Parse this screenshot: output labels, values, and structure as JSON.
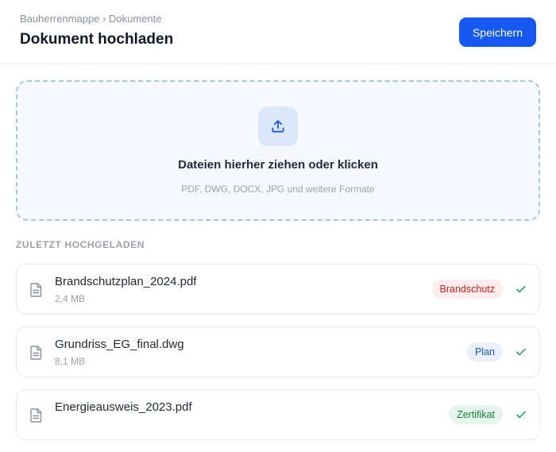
{
  "header": {
    "breadcrumb": "Bauherrenmappe › Dokumente",
    "title": "Dokument hochladen",
    "save_label": "Speichern"
  },
  "dropzone": {
    "icon": "upload-icon",
    "title": "Dateien hierher ziehen oder klicken",
    "hint": "PDF, DWG, DOCX, JPG und weitere Formate"
  },
  "recent": {
    "label": "ZULETZT HOCHGELADEN",
    "files": [
      {
        "name": "Brandschutzplan_2024.pdf",
        "size": "2,4 MB",
        "tag": "Brandschutz",
        "tag_color": "#cc1f1f",
        "tag_bg": "#fdecec",
        "status": "check-icon"
      },
      {
        "name": "Grundriss_EG_final.dwg",
        "size": "8,1 MB",
        "tag": "Plan",
        "tag_color": "#1e56c2",
        "tag_bg": "#e9f0fc",
        "status": "check-icon"
      },
      {
        "name": "Energieausweis_2023.pdf",
        "size": "",
        "tag": "Zertifikat",
        "tag_color": "#16803c",
        "tag_bg": "#e6f6ec",
        "status": "check-icon"
      }
    ]
  },
  "colors": {
    "accent": "#1559f0",
    "success": "#22a05a"
  }
}
